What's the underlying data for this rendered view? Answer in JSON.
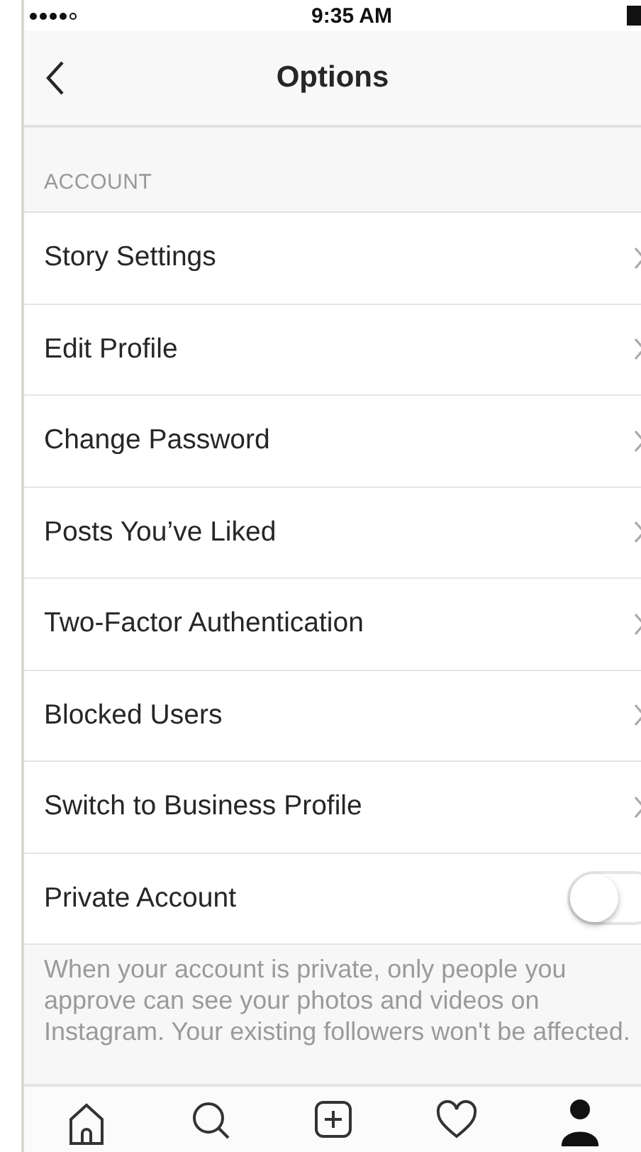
{
  "status_bar": {
    "time": "9:35 AM"
  },
  "nav": {
    "title": "Options"
  },
  "section": {
    "header": "ACCOUNT",
    "items": [
      {
        "kind": "link",
        "label": "Story Settings"
      },
      {
        "kind": "link",
        "label": "Edit Profile"
      },
      {
        "kind": "link",
        "label": "Change Password"
      },
      {
        "kind": "link",
        "label": "Posts You’ve Liked"
      },
      {
        "kind": "link",
        "label": "Two-Factor Authentication"
      },
      {
        "kind": "link",
        "label": "Blocked Users"
      },
      {
        "kind": "link",
        "label": "Switch to Business Profile"
      },
      {
        "kind": "toggle",
        "label": "Private Account",
        "on": false
      }
    ],
    "footer": "When your account is private, only people you approve can see your photos and videos on Instagram. Your existing followers won't be affected."
  },
  "tab_bar": {
    "items": [
      {
        "kind": "home",
        "selected": false
      },
      {
        "kind": "search",
        "selected": false
      },
      {
        "kind": "add",
        "selected": false
      },
      {
        "kind": "heart",
        "selected": false
      },
      {
        "kind": "profile",
        "selected": true
      }
    ]
  }
}
